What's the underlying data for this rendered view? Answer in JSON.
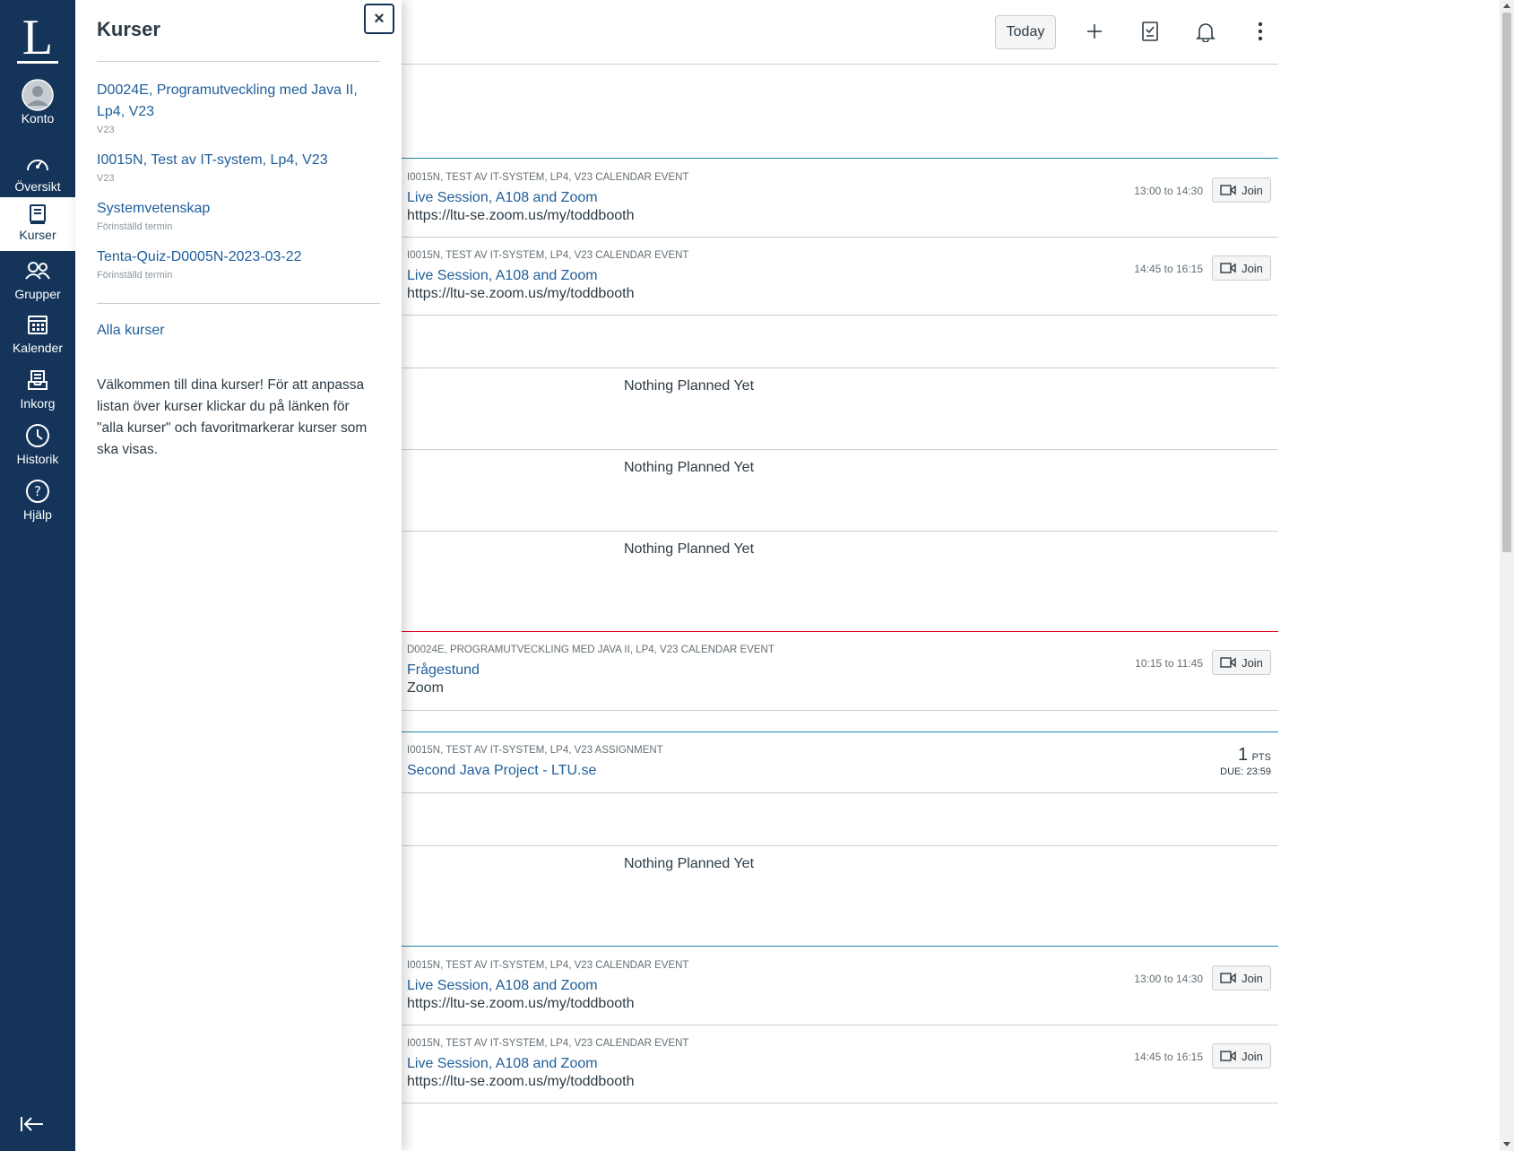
{
  "nav": {
    "logo": "L",
    "items": [
      {
        "label": "Konto",
        "icon": "avatar-icon"
      },
      {
        "label": "Översikt",
        "icon": "dashboard-icon"
      },
      {
        "label": "Kurser",
        "icon": "courses-icon"
      },
      {
        "label": "Grupper",
        "icon": "groups-icon"
      },
      {
        "label": "Kalender",
        "icon": "calendar-icon"
      },
      {
        "label": "Inkorg",
        "icon": "inbox-icon"
      },
      {
        "label": "Historik",
        "icon": "history-icon"
      },
      {
        "label": "Hjälp",
        "icon": "help-icon"
      }
    ],
    "colors": {
      "background": "#14345a",
      "active_background": "#ffffff"
    }
  },
  "tray": {
    "title": "Kurser",
    "close_symbol": "×",
    "courses": [
      {
        "name": "D0024E, Programutveckling med Java II, Lp4, V23",
        "term": "V23"
      },
      {
        "name": "I0015N, Test av IT-system, Lp4, V23",
        "term": "V23"
      },
      {
        "name": "Systemvetenskap",
        "term": "Förinställd termin"
      },
      {
        "name": "Tenta-Quiz-D0005N-2023-03-22",
        "term": "Förinställd termin"
      }
    ],
    "all_courses": "Alla kurser",
    "welcome": "Välkommen till dina kurser! För att anpassa listan över kurser klickar du på länken för \"alla kurser\" och favoritmarkerar kurser som ska visas."
  },
  "header": {
    "today": "Today"
  },
  "planner": {
    "items": [
      {
        "context": "I0015N, TEST AV IT-SYSTEM, LP4, V23 CALENDAR EVENT",
        "title": "Live Session, A108 and Zoom",
        "subtitle": "https://ltu-se.zoom.us/my/toddbooth",
        "time": "13:00 to 14:30",
        "join": "Join"
      },
      {
        "context": "I0015N, TEST AV IT-SYSTEM, LP4, V23 CALENDAR EVENT",
        "title": "Live Session, A108 and Zoom",
        "subtitle": "https://ltu-se.zoom.us/my/toddbooth",
        "time": "14:45 to 16:15",
        "join": "Join"
      },
      {
        "context": "D0024E, PROGRAMUTVECKLING MED JAVA II, LP4, V23 CALENDAR EVENT",
        "title": "Frågestund",
        "subtitle": "Zoom",
        "time": "10:15 to 11:45",
        "join": "Join"
      },
      {
        "context": "I0015N, TEST AV IT-SYSTEM, LP4, V23 ASSIGNMENT",
        "title": "Second Java Project - LTU.se",
        "points": "1",
        "points_unit": "PTS",
        "due": "DUE: 23:59"
      },
      {
        "context": "I0015N, TEST AV IT-SYSTEM, LP4, V23 CALENDAR EVENT",
        "title": "Live Session, A108 and Zoom",
        "subtitle": "https://ltu-se.zoom.us/my/toddbooth",
        "time": "13:00 to 14:30",
        "join": "Join"
      },
      {
        "context": "I0015N, TEST AV IT-SYSTEM, LP4, V23 CALENDAR EVENT",
        "title": "Live Session, A108 and Zoom",
        "subtitle": "https://ltu-se.zoom.us/my/toddbooth",
        "time": "14:45 to 16:15",
        "join": "Join"
      }
    ],
    "nothing_planned": "Nothing Planned Yet",
    "colors": {
      "link": "#1f5e9b",
      "course_blue": "#1b8aab",
      "course_red": "#e0061f"
    }
  }
}
